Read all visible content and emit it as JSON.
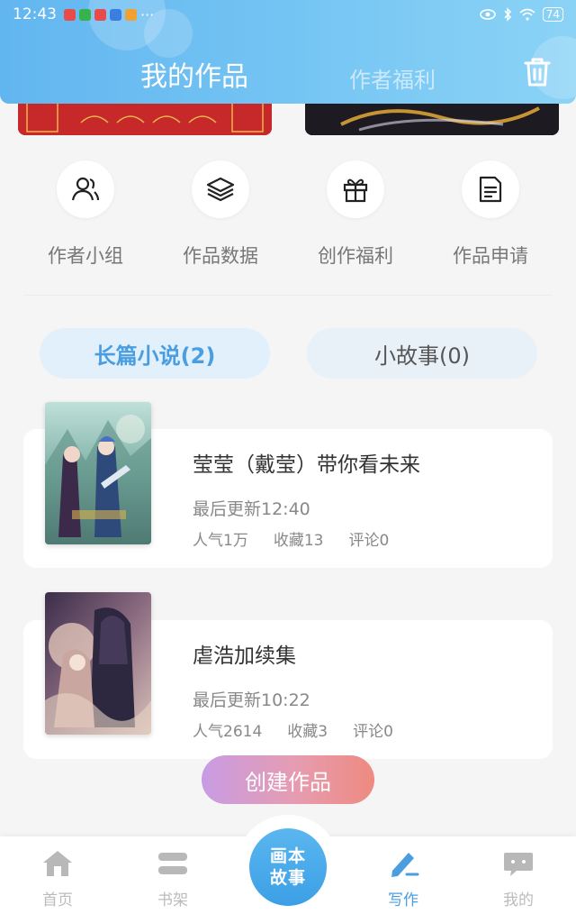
{
  "status_bar": {
    "time": "12:43",
    "more": "···",
    "battery": "74"
  },
  "header": {
    "tab_mine": "我的作品",
    "tab_welfare": "作者福利",
    "trash_icon": "trash-icon"
  },
  "quick_actions": [
    {
      "label": "作者小组",
      "icon": "users-icon"
    },
    {
      "label": "作品数据",
      "icon": "layers-icon"
    },
    {
      "label": "创作福利",
      "icon": "gift-icon"
    },
    {
      "label": "作品申请",
      "icon": "document-icon"
    }
  ],
  "categories": {
    "novel": "长篇小说(2)",
    "story": "小故事(0)"
  },
  "works": [
    {
      "title": "莹莹（戴莹）带你看未来",
      "updated": "最后更新12:40",
      "popularity": "人气1万",
      "favorites": "收藏13",
      "comments": "评论0"
    },
    {
      "title": "虐浩加续集",
      "updated": "最后更新10:22",
      "popularity": "人气2614",
      "favorites": "收藏3",
      "comments": "评论0"
    }
  ],
  "create_button": "创建作品",
  "bottom_nav": {
    "home": "首页",
    "shelf": "书架",
    "center_line1": "画本",
    "center_line2": "故事",
    "write": "写作",
    "mine": "我的"
  },
  "colors": {
    "accent": "#4a9ee0",
    "header_start": "#62b6f0",
    "header_end": "#8bd3f6"
  }
}
